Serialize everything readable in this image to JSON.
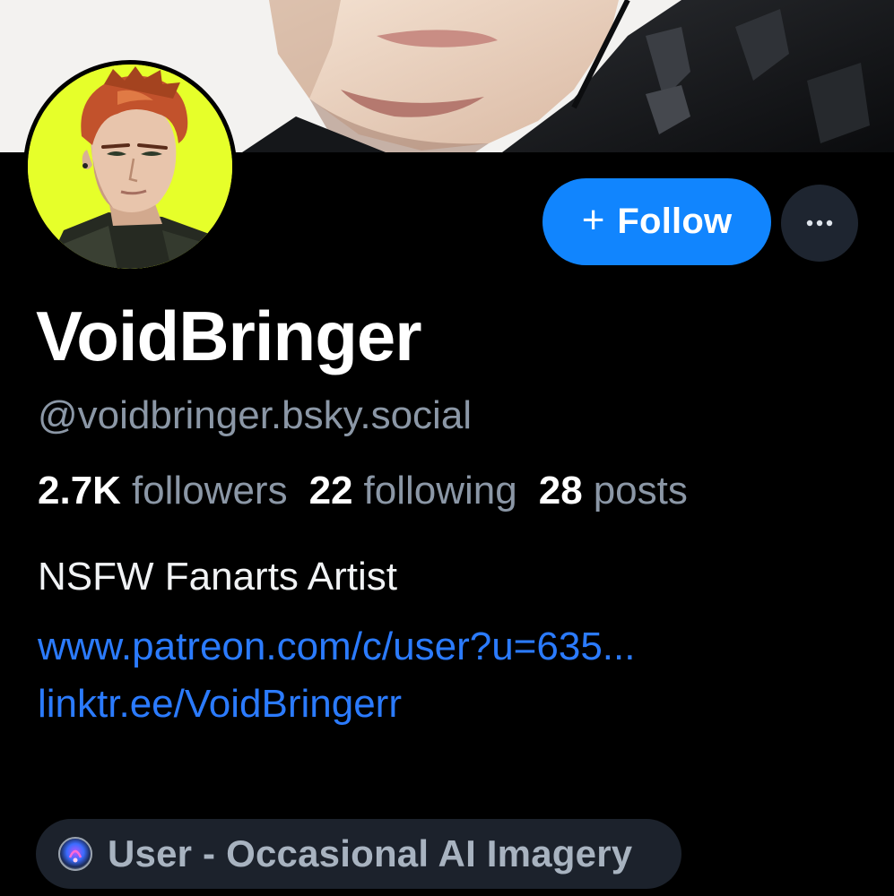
{
  "profile": {
    "display_name": "VoidBringer",
    "handle": "@voidbringer.bsky.social",
    "stats": {
      "followers_count": "2.7K",
      "followers_label": "followers",
      "following_count": "22",
      "following_label": "following",
      "posts_count": "28",
      "posts_label": "posts"
    },
    "bio": "NSFW Fanarts Artist",
    "links": [
      "www.patreon.com/c/user?u=635...",
      "linktr.ee/VoidBringerr"
    ],
    "label": {
      "icon": "labeler-avatar-icon",
      "text": "User - Occasional AI Imagery"
    }
  },
  "actions": {
    "follow_icon": "+",
    "follow_label": "Follow",
    "more_icon": "ellipsis-icon"
  },
  "colors": {
    "background": "#000000",
    "accent": "#1185fe",
    "link": "#2b7bff",
    "muted_text": "#8b97a6",
    "avatar_background": "#e6ff2a",
    "pill_background": "#1c222c"
  }
}
